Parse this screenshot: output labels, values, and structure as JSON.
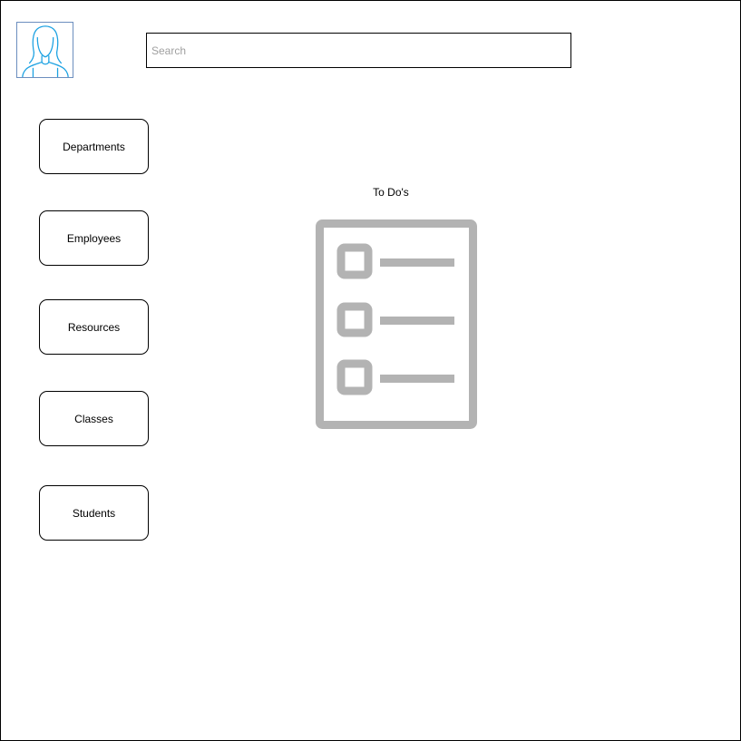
{
  "header": {
    "avatar_icon": "user-avatar-female-icon",
    "search": {
      "placeholder": "Search",
      "value": ""
    }
  },
  "sidebar": {
    "items": [
      {
        "label": "Departments"
      },
      {
        "label": "Employees"
      },
      {
        "label": "Resources"
      },
      {
        "label": "Classes"
      },
      {
        "label": "Students"
      }
    ]
  },
  "main": {
    "todo_title": "To Do's",
    "todo_icon": "checklist-icon"
  },
  "colors": {
    "avatar_stroke": "#1ba1e2",
    "checklist_gray": "#b3b3b3",
    "border": "#000000",
    "placeholder": "#a0a0a0"
  }
}
